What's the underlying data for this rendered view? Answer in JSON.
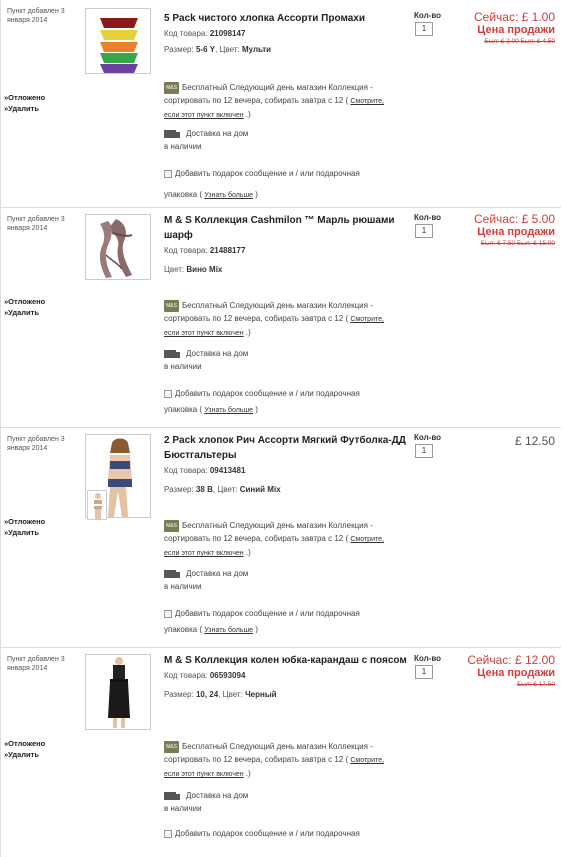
{
  "items": [
    {
      "added": "Пункт добавлен 3 января 2014",
      "saved": "»Отложено",
      "remove": "»Удалить",
      "title": "5 Pack чистого хлопка Ассорти Промахи",
      "sku_label": "Код товара:",
      "sku": "21098147",
      "attr_label1": "Размер:",
      "attr_value1": "5-6 Y",
      "attr_label2": "Цвет:",
      "attr_value2": "Мульти",
      "qty_label": "Кол-во",
      "qty": "1",
      "price_now": "Сейчас: £ 1.00",
      "sale_label": "Цена продажи",
      "was": "Был: £ 2.00 Был: £ 4.50"
    },
    {
      "added": "Пункт добавлен 3 января 2014",
      "saved": "»Отложено",
      "remove": "»Удалить",
      "title": "M & S Коллекция Cashmilon ™ Марль рюшами шарф",
      "sku_label": "Код товара:",
      "sku": "21488177",
      "attr_label1": "Цвет:",
      "attr_value1": "Вино Mix",
      "qty_label": "Кол-во",
      "qty": "1",
      "price_now": "Сейчас: £ 5.00",
      "sale_label": "Цена продажи",
      "was": "Был: £ 7.50 Был: £ 15.00"
    },
    {
      "added": "Пункт добавлен 3 января 2014",
      "saved": "»Отложено",
      "remove": "»Удалить",
      "title": "2 Pack хлопок Рич Ассорти Мягкий Футболка-ДД Бюстгальтеры",
      "sku_label": "Код товара:",
      "sku": "09413481",
      "attr_label1": "Размер:",
      "attr_value1": "38 B",
      "attr_label2": "Цвет:",
      "attr_value2": "Синий Mix",
      "qty_label": "Кол-во",
      "qty": "1",
      "price": "£ 12.50"
    },
    {
      "added": "Пункт добавлен 3 января 2014",
      "saved": "»Отложено",
      "remove": "»Удалить",
      "title": "M & S Коллекция колен юбка-карандаш с поясом",
      "sku_label": "Код товара:",
      "sku": "06593094",
      "attr_label1": "Размер:",
      "attr_value1": "10, 24",
      "attr_label2": "Цвет:",
      "attr_value2": "Черный",
      "qty_label": "Кол-во",
      "qty": "1",
      "price_now": "Сейчас: £ 12.00",
      "sale_label": "Цена продажи",
      "was": "Был: £ 17.50"
    }
  ],
  "shared": {
    "store_icon": "M&S",
    "store_text1": "Бесплатный Следующий день магазин Коллекция -",
    "store_text2": "сортировать по 12 вечера, собирать завтра с 12 (",
    "store_link1": "Смотрите,",
    "store_link2": "если этот пункт включен",
    "store_text3": ".)",
    "home_delivery": "Доставка на дом",
    "in_stock": "в наличии",
    "gift_text": "Добавить подарок сообщение и / или подарочная",
    "gift_text2": "упаковка (",
    "learn_more": "Узнать больше",
    "gift_close": ")",
    "separator": ",",
    "truck_icon": "truck-icon",
    "checkbox_icon": "checkbox-icon"
  }
}
